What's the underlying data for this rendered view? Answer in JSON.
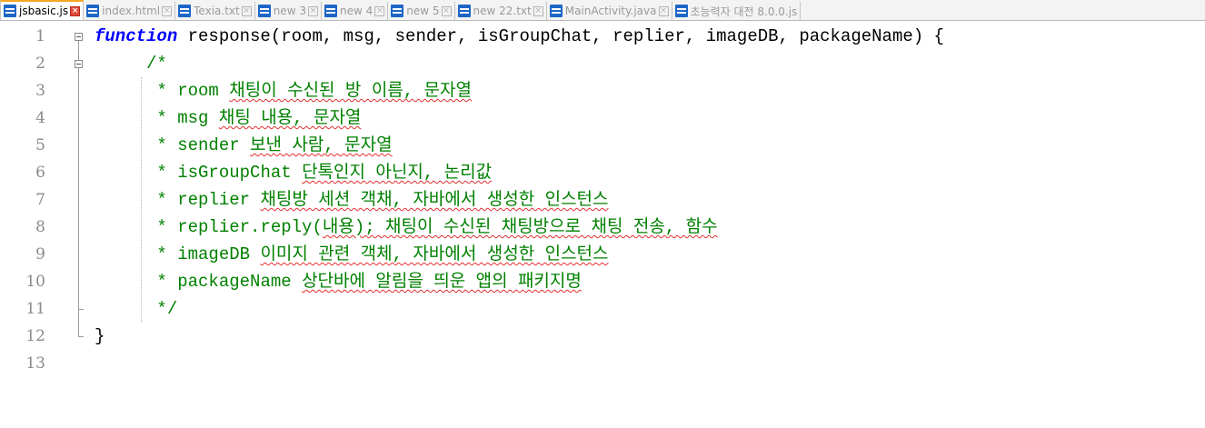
{
  "tabs": [
    {
      "label": "jsbasic.js",
      "active": true
    },
    {
      "label": "index.html",
      "active": false
    },
    {
      "label": "Texia.txt",
      "active": false
    },
    {
      "label": "new  3",
      "active": false
    },
    {
      "label": "new  4",
      "active": false
    },
    {
      "label": "new  5",
      "active": false
    },
    {
      "label": "new  22.txt",
      "active": false
    },
    {
      "label": "MainActivity.java",
      "active": false
    },
    {
      "label": "초능력자 대전 8.0.0.js",
      "active": false
    }
  ],
  "colors": {
    "keyword": "#0000ff",
    "comment": "#008000",
    "line_number": "#8a8a8a",
    "active_tab_accent": "#f6a623",
    "tab_close_active": "#e24b3a",
    "file_icon": "#1d66c7"
  },
  "lines": [
    {
      "number": "1",
      "keyword": "function",
      "text": " response(room, msg, sender, isGroupChat, replier, imageDB, packageName) {"
    },
    {
      "number": "2",
      "prefix": "     ",
      "comment": "/*"
    },
    {
      "number": "3",
      "prefix": "      ",
      "comment": "* room ",
      "korean": "채팅이 수신된 방 이름, 문자열"
    },
    {
      "number": "4",
      "prefix": "      ",
      "comment": "* msg ",
      "korean": "채팅 내용, 문자열"
    },
    {
      "number": "5",
      "prefix": "      ",
      "comment": "* sender ",
      "korean": "보낸 사람, 문자열"
    },
    {
      "number": "6",
      "prefix": "      ",
      "comment": "* isGroupChat ",
      "korean": "단톡인지 아닌지, 논리값"
    },
    {
      "number": "7",
      "prefix": "      ",
      "comment": "* replier ",
      "korean": "채팅방 세션 객채, 자바에서 생성한 인스턴스"
    },
    {
      "number": "8",
      "prefix": "      ",
      "comment": "* replier.reply(",
      "korean": "내용); 채팅이 수신된 채팅방으로 채팅 전송, 함수"
    },
    {
      "number": "9",
      "prefix": "      ",
      "comment": "* imageDB ",
      "korean": "이미지 관련 객체, 자바에서 생성한 인스턴스"
    },
    {
      "number": "10",
      "prefix": "      ",
      "comment": "* packageName ",
      "korean": "상단바에 알림을 띄운 앱의 패키지명"
    },
    {
      "number": "11",
      "prefix": "      ",
      "comment": "*/"
    },
    {
      "number": "12",
      "text": "}"
    },
    {
      "number": "13",
      "text": ""
    }
  ]
}
